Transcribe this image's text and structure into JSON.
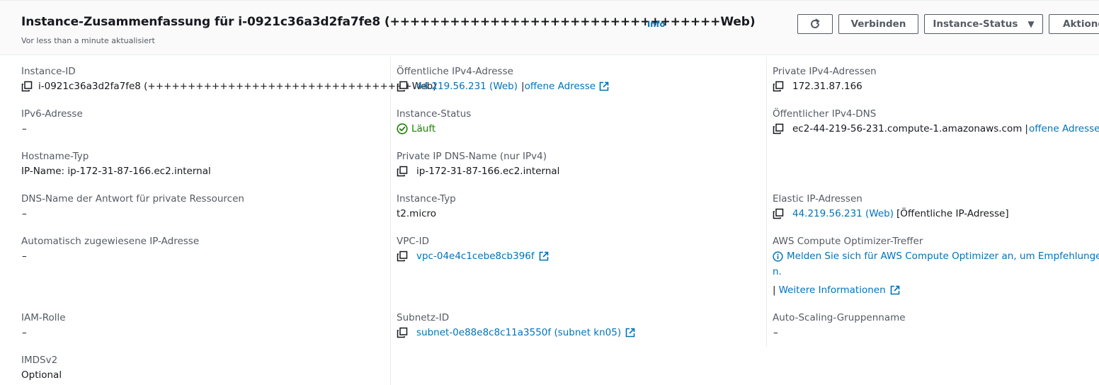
{
  "header": {
    "title": "Instance-Zusammenfassung für i-0921c36a3d2fa7fe8 (+++++++++++++++++++++++++++++++++Web)",
    "info_label": "Info",
    "subtitle": "Vor less than a minute aktualisiert",
    "buttons": {
      "refresh_icon": "refresh-icon",
      "connect": "Verbinden",
      "instance_status": "Instance-Status",
      "actions": "Aktionen"
    }
  },
  "col1": {
    "instance_id": {
      "label": "Instance-ID",
      "value": "i-0921c36a3d2fa7fe8 (+++++++++++++++++++++++++++++++++Web)"
    },
    "ipv6": {
      "label": "IPv6-Adresse",
      "value": "–"
    },
    "hostname_type": {
      "label": "Hostname-Typ",
      "value": "IP-Name: ip-172-31-87-166.ec2.internal"
    },
    "dns_private": {
      "label": "DNS-Name der Antwort für private Ressourcen",
      "value": "–"
    },
    "auto_ip": {
      "label": "Automatisch zugewiesene IP-Adresse",
      "value": "–"
    },
    "iam_role": {
      "label": "IAM-Rolle",
      "value": "–"
    },
    "imdsv2": {
      "label": "IMDSv2",
      "value": "Optional"
    }
  },
  "col2": {
    "public_ipv4": {
      "label": "Öffentliche IPv4-Adresse",
      "value": "44.219.56.231 (Web)",
      "separator": "|",
      "open_link": "offene Adresse"
    },
    "instance_state": {
      "label": "Instance-Status",
      "value": "Läuft"
    },
    "private_dns": {
      "label": "Private IP DNS-Name (nur IPv4)",
      "value": "ip-172-31-87-166.ec2.internal"
    },
    "instance_type": {
      "label": "Instance-Typ",
      "value": "t2.micro"
    },
    "vpc_id": {
      "label": "VPC-ID",
      "value": "vpc-04e4c1cebe8cb396f"
    },
    "subnet_id": {
      "label": "Subnetz-ID",
      "value": "subnet-0e88e8c8c11a3550f (subnet kn05)"
    }
  },
  "col3": {
    "private_ipv4": {
      "label": "Private IPv4-Adressen",
      "value": "172.31.87.166"
    },
    "public_dns": {
      "label": "Öffentlicher IPv4-DNS",
      "value": "ec2-44-219-56-231.compute-1.amazonaws.com",
      "separator": "|",
      "open_link": "offene Adresse"
    },
    "elastic_ip": {
      "label": "Elastic IP-Adressen",
      "value": "44.219.56.231 (Web)",
      "suffix": "[Öffentliche IP-Adresse]"
    },
    "optimizer": {
      "label": "AWS Compute Optimizer-Treffer",
      "line1": "Melden Sie sich für AWS Compute Optimizer an, um Empfehlungen zu",
      "line2": "n.",
      "separator": "|",
      "more_link": "Weitere Informationen"
    },
    "asg": {
      "label": "Auto-Scaling-Gruppenname",
      "value": "–"
    }
  },
  "colors": {
    "link": "#0073bb",
    "running": "#1d8102",
    "label": "#545b64",
    "text": "#16191f"
  }
}
